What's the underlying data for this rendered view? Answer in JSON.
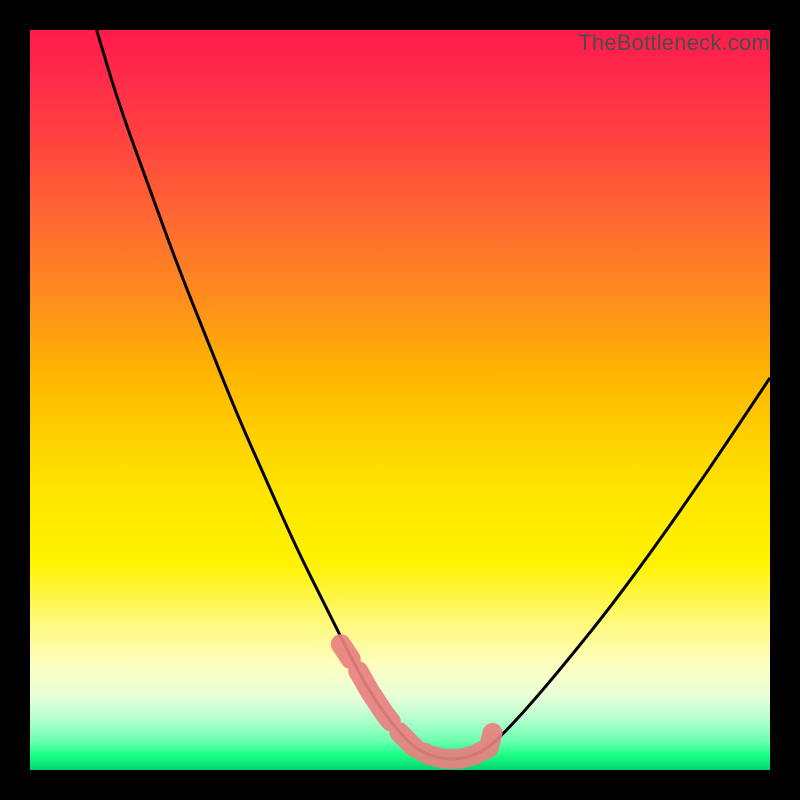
{
  "watermark": "TheBottleneck.com",
  "chart_data": {
    "type": "line",
    "title": "",
    "xlabel": "",
    "ylabel": "",
    "xlim": [
      0,
      100
    ],
    "ylim": [
      0,
      100
    ],
    "series": [
      {
        "name": "bottleneck-curve",
        "x": [
          9,
          12,
          16,
          20,
          24,
          28,
          32,
          36,
          40,
          44,
          46,
          48,
          50,
          52,
          54,
          56,
          58,
          60,
          62,
          66,
          72,
          80,
          90,
          100
        ],
        "values": [
          100,
          90,
          79,
          68,
          58,
          48,
          39,
          30,
          22,
          14,
          10.5,
          7.5,
          5,
          3,
          2,
          1.5,
          1.5,
          2,
          3,
          7,
          14,
          24,
          38,
          53
        ]
      },
      {
        "name": "highlight-band",
        "x": [
          42,
          44,
          46,
          48,
          50,
          52,
          54,
          56,
          58,
          60,
          62,
          62.5
        ],
        "values": [
          17,
          14,
          10.5,
          7.5,
          5,
          3,
          2,
          1.5,
          1.5,
          2,
          3,
          5
        ]
      }
    ],
    "colors": {
      "curve": "#000000",
      "highlight": "#e98080"
    }
  }
}
